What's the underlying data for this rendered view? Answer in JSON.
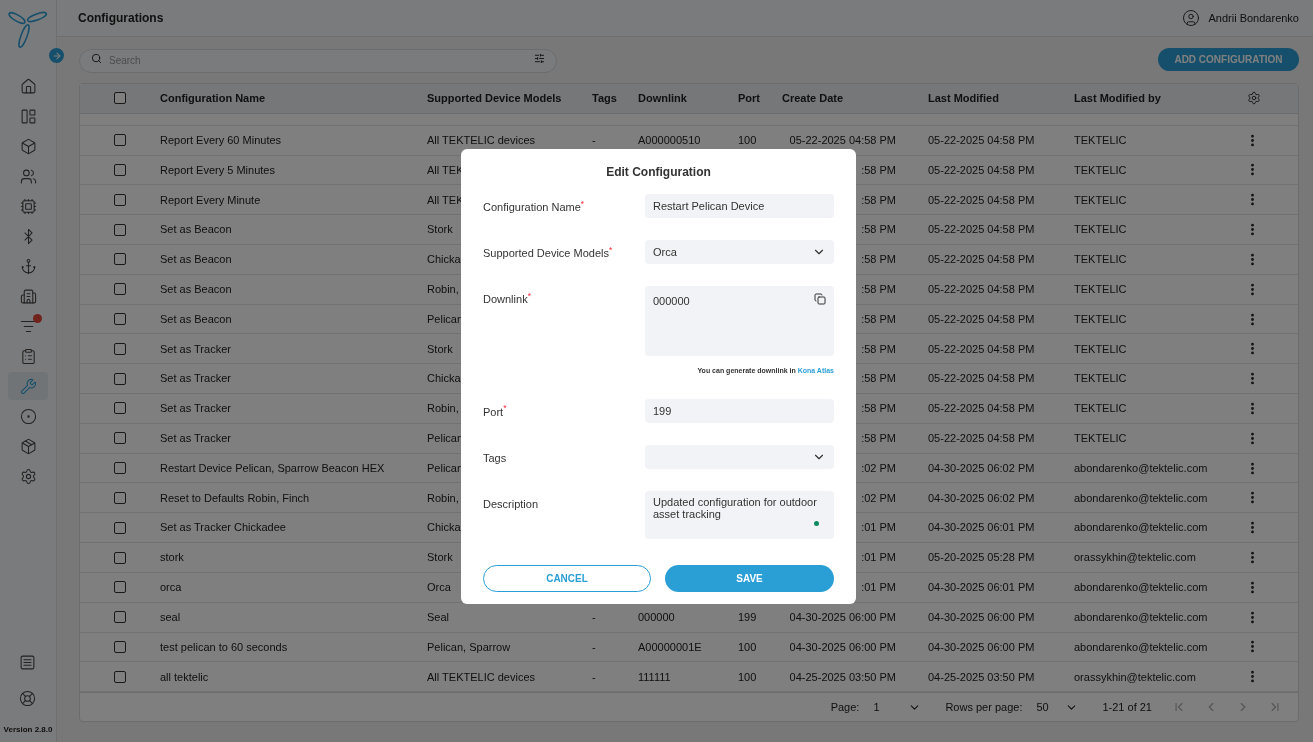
{
  "sidebar": {
    "items": [
      {
        "selected": false,
        "badge": false
      },
      {
        "selected": false,
        "badge": false
      },
      {
        "selected": false,
        "badge": false
      },
      {
        "selected": false,
        "badge": false
      },
      {
        "selected": false,
        "badge": false
      },
      {
        "selected": false,
        "badge": false
      },
      {
        "selected": false,
        "badge": false
      },
      {
        "selected": false,
        "badge": false
      },
      {
        "selected": false,
        "badge": true
      },
      {
        "selected": false,
        "badge": false
      },
      {
        "selected": true,
        "badge": false
      },
      {
        "selected": false,
        "badge": false
      },
      {
        "selected": false,
        "badge": false
      },
      {
        "selected": false,
        "badge": false
      }
    ],
    "bottom_items": [
      {
        "selected": false
      },
      {
        "selected": false
      }
    ],
    "version": "Version 2.8.0"
  },
  "header": {
    "title": "Configurations",
    "user": "Andrii Bondarenko"
  },
  "search": {
    "placeholder": "Search"
  },
  "add_button": "ADD CONFIGURATION",
  "table": {
    "header_checked": false,
    "columns": [
      "Configuration Name",
      "Supported Device Models",
      "Tags",
      "Downlink",
      "Port",
      "Create Date",
      "Last Modified",
      "Last Modified by"
    ],
    "rows": [
      {
        "checked": false,
        "name": "Report Every 60 Minutes",
        "models": "All TEKTELIC devices",
        "tags": "-",
        "downlink": "A000000510",
        "port": "100",
        "created": "05-22-2025 04:58 PM",
        "modified": "05-22-2025 04:58 PM",
        "by": "TEKTELIC"
      },
      {
        "checked": false,
        "name": "Report Every 5 Minutes",
        "models": "All TEK",
        "created": ":58 PM",
        "modified": "05-22-2025 04:58 PM",
        "by": "TEKTELIC"
      },
      {
        "checked": false,
        "name": "Report Every Minute",
        "models": "All TEK",
        "created": ":58 PM",
        "modified": "05-22-2025 04:58 PM",
        "by": "TEKTELIC"
      },
      {
        "checked": false,
        "name": "Set as Beacon",
        "models": "Stork",
        "created": ":58 PM",
        "modified": "05-22-2025 04:58 PM",
        "by": "TEKTELIC"
      },
      {
        "checked": false,
        "name": "Set as Beacon",
        "models": "Chicka",
        "created": ":58 PM",
        "modified": "05-22-2025 04:58 PM",
        "by": "TEKTELIC"
      },
      {
        "checked": false,
        "name": "Set as Beacon",
        "models": "Robin,",
        "created": ":58 PM",
        "modified": "05-22-2025 04:58 PM",
        "by": "TEKTELIC"
      },
      {
        "checked": false,
        "name": "Set as Beacon",
        "models": "Pelican",
        "created": ":58 PM",
        "modified": "05-22-2025 04:58 PM",
        "by": "TEKTELIC"
      },
      {
        "checked": false,
        "name": "Set as Tracker",
        "models": "Stork",
        "created": ":58 PM",
        "modified": "05-22-2025 04:58 PM",
        "by": "TEKTELIC"
      },
      {
        "checked": false,
        "name": "Set as Tracker",
        "models": "Chicka",
        "created": ":58 PM",
        "modified": "05-22-2025 04:58 PM",
        "by": "TEKTELIC"
      },
      {
        "checked": false,
        "name": "Set as Tracker",
        "models": "Robin,",
        "created": ":58 PM",
        "modified": "05-22-2025 04:58 PM",
        "by": "TEKTELIC"
      },
      {
        "checked": false,
        "name": "Set as Tracker",
        "models": "Pelican",
        "created": ":58 PM",
        "modified": "05-22-2025 04:58 PM",
        "by": "TEKTELIC"
      },
      {
        "checked": false,
        "name": "Restart Device Pelican, Sparrow Beacon HEX",
        "models": "Pelican",
        "created": ":02 PM",
        "modified": "04-30-2025 06:02 PM",
        "by": "abondarenko@tektelic.com"
      },
      {
        "checked": false,
        "name": "Reset to Defaults Robin, Finch",
        "models": "Robin,",
        "created": ":02 PM",
        "modified": "04-30-2025 06:02 PM",
        "by": "abondarenko@tektelic.com"
      },
      {
        "checked": false,
        "name": "Set as Tracker Chickadee",
        "models": "Chicka",
        "created": ":01 PM",
        "modified": "04-30-2025 06:01 PM",
        "by": "abondarenko@tektelic.com"
      },
      {
        "checked": false,
        "name": "stork",
        "models": "Stork",
        "created": ":01 PM",
        "modified": "05-20-2025 05:28 PM",
        "by": "orassykhin@tektelic.com"
      },
      {
        "checked": false,
        "name": "orca",
        "models": "Orca",
        "created": ":01 PM",
        "modified": "04-30-2025 06:01 PM",
        "by": "abondarenko@tektelic.com"
      },
      {
        "checked": false,
        "name": "seal",
        "models": "Seal",
        "tags": "-",
        "downlink": "000000",
        "port": "199",
        "created": "04-30-2025 06:00 PM",
        "modified": "04-30-2025 06:00 PM",
        "by": "abondarenko@tektelic.com"
      },
      {
        "checked": false,
        "name": "test pelican to 60 seconds",
        "models": "Pelican, Sparrow",
        "tags": "-",
        "downlink": "A00000001E",
        "port": "100",
        "created": "04-30-2025 06:00 PM",
        "modified": "04-30-2025 06:00 PM",
        "by": "abondarenko@tektelic.com"
      },
      {
        "checked": false,
        "name": "all tektelic",
        "models": "All TEKTELIC devices",
        "tags": "-",
        "downlink": "111111",
        "port": "100",
        "created": "04-25-2025 03:50 PM",
        "modified": "04-25-2025 03:50 PM",
        "by": "orassykhin@tektelic.com"
      }
    ]
  },
  "pagination": {
    "page_label": "Page:",
    "page": "1",
    "rows_label": "Rows per page:",
    "rows": "50",
    "range": "1-21 of 21"
  },
  "dialog": {
    "title": "Edit Configuration",
    "fields": [
      {
        "kind": "text",
        "label": "Configuration Name$^{*}$",
        "value": "Restart Pelican Device"
      },
      {
        "kind": "select",
        "label": "Supported Device Models$^{*}$",
        "value": "Orca"
      },
      {
        "kind": "code",
        "label": "Downlink$^{*}$",
        "value": "000000",
        "hint": "You can generate downlink in ",
        "link": "Kona Atlas"
      },
      {
        "kind": "text",
        "label": "Port$^{*}$",
        "value": "199"
      },
      {
        "kind": "select",
        "label": "Tags"
      },
      {
        "kind": "textarea",
        "label": "Description",
        "value": "Updated configuration for outdoor asset tracking"
      }
    ],
    "cancel": "CANCEL",
    "save": "SAVE"
  }
}
